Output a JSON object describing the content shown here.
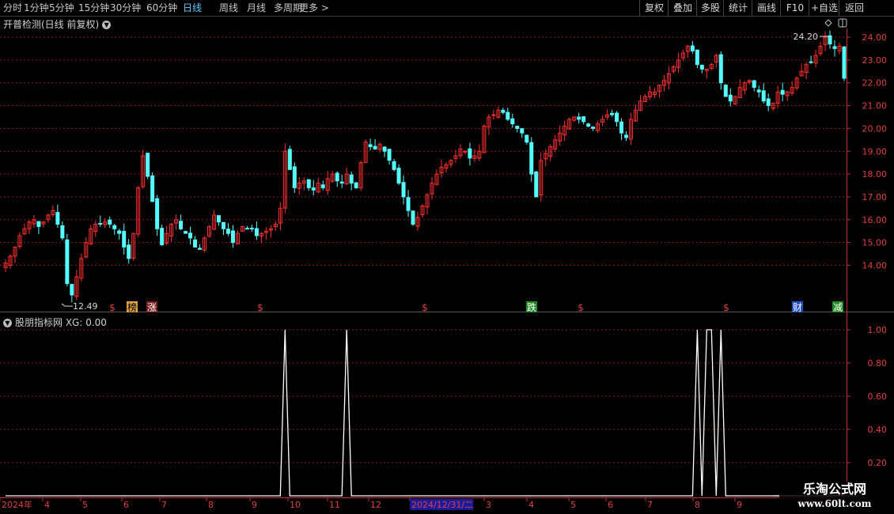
{
  "toolbar": {
    "periods": [
      {
        "label": "分时"
      },
      {
        "label": "1分钟"
      },
      {
        "label": "5分钟"
      },
      {
        "label": "15分钟"
      },
      {
        "label": "30分钟"
      },
      {
        "label": "60分钟"
      },
      {
        "label": "日线",
        "active": true
      },
      {
        "label": "周线"
      },
      {
        "label": "月线"
      },
      {
        "label": "多周期"
      },
      {
        "label": "更多 >"
      }
    ],
    "right_buttons": [
      {
        "label": "复权"
      },
      {
        "label": "叠加"
      },
      {
        "label": "多股"
      },
      {
        "label": "统计"
      },
      {
        "label": "画线"
      },
      {
        "label": "F10"
      },
      {
        "label": "+自选"
      },
      {
        "label": "返回"
      }
    ]
  },
  "main_panel": {
    "title": "开普检测(日线 前复权)",
    "price_axis_labels": [
      "24.00",
      "23.00",
      "22.00",
      "21.00",
      "20.00",
      "19.00",
      "18.00",
      "17.00",
      "16.00",
      "15.00",
      "14.00"
    ],
    "low_marker": "12.49",
    "high_marker": "24.20",
    "event_markers": [
      {
        "text": "$",
        "color": "#e04040"
      },
      {
        "text": "榜",
        "color": "#000",
        "bg": "#e0a040"
      },
      {
        "text": "涨",
        "color": "#ffffff",
        "bg": "#7a1a1a"
      },
      {
        "text": "$",
        "color": "#e04040"
      },
      {
        "text": "$",
        "color": "#e04040"
      },
      {
        "text": "跌",
        "color": "#ffffff",
        "bg": "#1f8a1f"
      },
      {
        "text": "$",
        "color": "#e04040"
      },
      {
        "text": "$",
        "color": "#e04040"
      },
      {
        "text": "财",
        "color": "#ffffff",
        "bg": "#2050c0"
      },
      {
        "text": "减",
        "color": "#ffffff",
        "bg": "#1f8a1f"
      }
    ]
  },
  "indicator_panel": {
    "title": "股朋指标网 XG: 0.00",
    "axis_labels": [
      "1.00",
      "0.80",
      "0.60",
      "0.40",
      "0.20"
    ]
  },
  "chart_data": [
    {
      "type": "candlestick",
      "title": "开普检测(日线 前复权)",
      "ylim": [
        12.0,
        24.4
      ],
      "close_series_approx": [
        14.1,
        14.4,
        14.8,
        15.3,
        15.6,
        15.9,
        16.0,
        15.7,
        15.9,
        16.2,
        16.4,
        15.8,
        15.2,
        13.2,
        12.7,
        13.5,
        14.3,
        15.0,
        15.6,
        15.8,
        15.8,
        15.9,
        15.8,
        15.6,
        15.4,
        14.8,
        14.3,
        15.4,
        17.4,
        18.8,
        17.9,
        16.8,
        15.6,
        14.9,
        15.4,
        15.8,
        16.0,
        15.6,
        15.4,
        15.2,
        14.8,
        14.7,
        15.2,
        15.7,
        16.2,
        15.9,
        15.6,
        15.4,
        15.0,
        15.4,
        15.7,
        15.6,
        15.6,
        15.3,
        15.4,
        15.5,
        15.6,
        15.8,
        16.5,
        19.0,
        18.2,
        17.4,
        17.6,
        17.7,
        17.4,
        17.3,
        17.6,
        17.4,
        17.8,
        18.0,
        17.7,
        17.6,
        18.0,
        17.6,
        17.4,
        18.5,
        19.4,
        19.2,
        19.1,
        19.3,
        19.0,
        18.6,
        18.2,
        17.6,
        17.0,
        16.4,
        15.8,
        16.1,
        16.6,
        17.1,
        17.6,
        18.0,
        18.3,
        18.4,
        18.6,
        18.8,
        19.1,
        19.0,
        18.7,
        18.8,
        19.0,
        20.1,
        20.5,
        20.6,
        20.8,
        20.7,
        20.4,
        20.2,
        20.0,
        19.8,
        19.4,
        18.0,
        17.0,
        18.6,
        18.9,
        19.2,
        19.5,
        19.8,
        20.1,
        20.4,
        20.5,
        20.4,
        20.3,
        20.1,
        20.0,
        20.2,
        20.4,
        20.6,
        20.6,
        20.3,
        19.8,
        19.6,
        20.4,
        20.8,
        21.2,
        21.4,
        21.6,
        21.6,
        21.9,
        22.1,
        22.4,
        22.7,
        23.0,
        23.3,
        23.6,
        23.4,
        22.8,
        22.6,
        22.6,
        22.8,
        23.2,
        22.0,
        21.4,
        21.2,
        21.4,
        21.8,
        22.0,
        22.1,
        21.8,
        21.6,
        21.2,
        21.0,
        21.1,
        21.6,
        21.5,
        21.6,
        21.8,
        22.2,
        22.5,
        22.8,
        22.9,
        23.2,
        23.6,
        24.0,
        23.7,
        23.5,
        23.6,
        22.2
      ]
    },
    {
      "type": "line",
      "title": "股朋指标网",
      "series": [
        {
          "name": "XG",
          "values": [
            0,
            0,
            0,
            0,
            0,
            0,
            0,
            0,
            0,
            0,
            0,
            0,
            0,
            0,
            0,
            0,
            0,
            0,
            0,
            0,
            0,
            0,
            0,
            0,
            0,
            0,
            0,
            0,
            0,
            0,
            0,
            0,
            0,
            0,
            0,
            0,
            0,
            0,
            0,
            0,
            0,
            0,
            0,
            0,
            0,
            0,
            0,
            0,
            0,
            0,
            0,
            0,
            0,
            0,
            0,
            0,
            0,
            0,
            0,
            1,
            0,
            0,
            0,
            0,
            0,
            0,
            0,
            0,
            0,
            0,
            0,
            0,
            1,
            0,
            0,
            0,
            0,
            0,
            0,
            0,
            0,
            0,
            0,
            0,
            0,
            0,
            0,
            0,
            0,
            0,
            0,
            0,
            0,
            0,
            0,
            0,
            0,
            0,
            0,
            0,
            0,
            0,
            0,
            0,
            0,
            0,
            0,
            0,
            0,
            0,
            0,
            0,
            0,
            0,
            0,
            0,
            0,
            0,
            0,
            0,
            0,
            0,
            0,
            0,
            0,
            0,
            0,
            0,
            0,
            0,
            0,
            0,
            0,
            0,
            0,
            0,
            0,
            0,
            0,
            0,
            0,
            0,
            0,
            0,
            0,
            0,
            1,
            0,
            1,
            1,
            0,
            1,
            0,
            0,
            0,
            0,
            0,
            0,
            0,
            0,
            0,
            0,
            0,
            0,
            0,
            0,
            0,
            0,
            0,
            0,
            0,
            0,
            0,
            0,
            0,
            0,
            0,
            0,
            0,
            0,
            0
          ]
        }
      ],
      "ylim": [
        0,
        1.05
      ]
    }
  ],
  "date_axis": {
    "labels": [
      "2024年",
      "4",
      "5",
      "6",
      "7",
      "8",
      "9",
      "10",
      "11",
      "12",
      "2024/12/31/二",
      "3",
      "4",
      "5",
      "6",
      "7",
      "8",
      "9"
    ],
    "highlighted": "2024/12/31/二"
  },
  "watermark": {
    "line1": "乐淘公式网",
    "line2": "www.60lt.com"
  },
  "colors": {
    "up": "#ff3030",
    "down": "#54ffff",
    "grid": "#8a1a1a",
    "axis": "#c03030",
    "xg": "#ffffff"
  }
}
